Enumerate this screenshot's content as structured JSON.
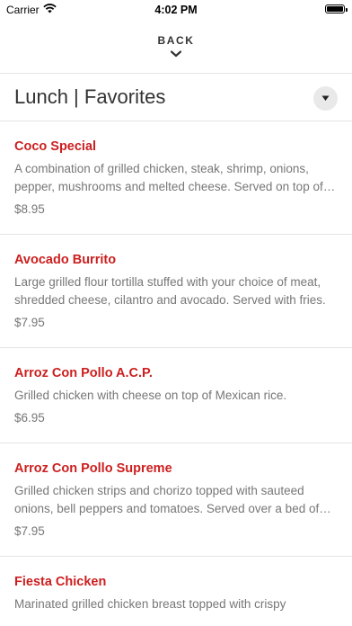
{
  "status_bar": {
    "carrier": "Carrier",
    "time": "4:02 PM",
    "icons": [
      "wifi-icon",
      "battery-icon"
    ]
  },
  "nav": {
    "back_label": "BACK",
    "back_icon": "chevron-down-icon"
  },
  "header": {
    "title": "Lunch | Favorites",
    "dropdown_icon": "caret-down-icon"
  },
  "colors": {
    "item_name": "#cc1f1f",
    "description": "#777777",
    "title": "#333333"
  },
  "menu_items": [
    {
      "name": "Coco Special",
      "description": "A combination of grilled chicken, steak, shrimp, onions, pepper, mushrooms and melted cheese. Served on top of rice.",
      "price": "$8.95"
    },
    {
      "name": "Avocado Burrito",
      "description": "Large grilled flour tortilla stuffed with your choice of meat, shredded cheese, cilantro and avocado. Served with fries.",
      "price": "$7.95"
    },
    {
      "name": "Arroz Con Pollo A.C.P.",
      "description": "Grilled chicken with cheese on top of Mexican rice.",
      "price": "$6.95"
    },
    {
      "name": "Arroz Con Pollo Supreme",
      "description": "Grilled chicken strips and chorizo topped with sauteed onions, bell peppers and tomatoes. Served over a bed of rice.",
      "price": "$7.95"
    },
    {
      "name": "Fiesta Chicken",
      "description": "Marinated grilled chicken breast topped with crispy",
      "price": ""
    }
  ]
}
